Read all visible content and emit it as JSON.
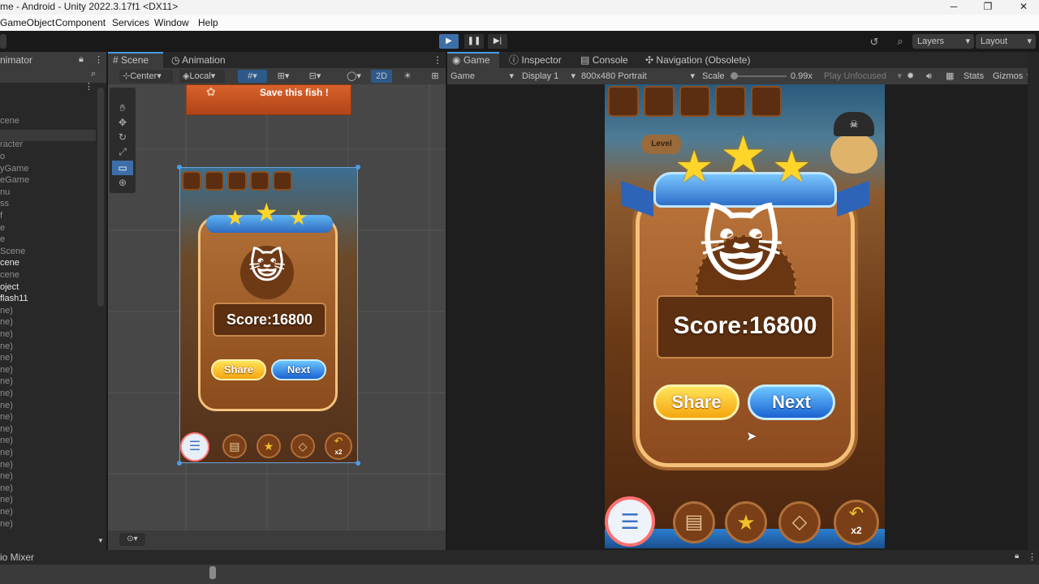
{
  "window": {
    "title": "me - Android - Unity 2022.3.17f1 <DX11>"
  },
  "menu": [
    "GameObject",
    "Component",
    "Services",
    "Window",
    "Help"
  ],
  "toolbar": {
    "layers": "Layers",
    "layout": "Layout"
  },
  "left_panel": {
    "tab": "nimator",
    "items": [
      {
        "text": "",
        "color": "grey"
      },
      {
        "text": "",
        "color": "grey"
      },
      {
        "text": "cene",
        "color": "grey"
      },
      {
        "text": "",
        "color": "grey"
      },
      {
        "text": "racter",
        "color": "grey"
      },
      {
        "text": "o",
        "color": "grey"
      },
      {
        "text": "yGame",
        "color": "grey"
      },
      {
        "text": "eGame",
        "color": "grey"
      },
      {
        "text": "nu",
        "color": "grey"
      },
      {
        "text": "ss",
        "color": "grey"
      },
      {
        "text": "f",
        "color": "grey"
      },
      {
        "text": "e",
        "color": "grey"
      },
      {
        "text": "e",
        "color": "grey"
      },
      {
        "text": "Scene",
        "color": "grey"
      },
      {
        "text": "cene",
        "color": "white"
      },
      {
        "text": "cene",
        "color": "grey"
      },
      {
        "text": "oject",
        "color": "white"
      },
      {
        "text": "flash11",
        "color": "white"
      },
      {
        "text": "ne)",
        "color": "grey"
      },
      {
        "text": "ne)",
        "color": "grey"
      },
      {
        "text": "ne)",
        "color": "grey"
      },
      {
        "text": "ne)",
        "color": "grey"
      },
      {
        "text": "ne)",
        "color": "grey"
      },
      {
        "text": "ne)",
        "color": "grey"
      },
      {
        "text": "ne)",
        "color": "grey"
      },
      {
        "text": "ne)",
        "color": "grey"
      },
      {
        "text": "ne)",
        "color": "grey"
      },
      {
        "text": "ne)",
        "color": "grey"
      },
      {
        "text": "ne)",
        "color": "grey"
      },
      {
        "text": "ne)",
        "color": "grey"
      },
      {
        "text": "ne)",
        "color": "grey"
      },
      {
        "text": "ne)",
        "color": "grey"
      },
      {
        "text": "ne)",
        "color": "grey"
      },
      {
        "text": "ne)",
        "color": "grey"
      },
      {
        "text": "ne)",
        "color": "grey"
      },
      {
        "text": "ne)",
        "color": "grey"
      },
      {
        "text": "ne)",
        "color": "grey"
      }
    ]
  },
  "scene_panel": {
    "tabs": [
      "Scene",
      "Animation"
    ],
    "pivot": "Center",
    "space": "Local",
    "mode_2d": "2D",
    "banner": "Save this fish !"
  },
  "game_panel": {
    "tabs": [
      "Game",
      "Inspector",
      "Console",
      "Navigation (Obsolete)"
    ],
    "view": "Game",
    "display": "Display 1",
    "resolution": "800x480 Portrait",
    "scale_label": "Scale",
    "scale_value": "0.99x",
    "play_mode": "Play Unfocused",
    "stats": "Stats",
    "gizmos": "Gizmos"
  },
  "game_screen": {
    "score": "Score:16800",
    "share": "Share",
    "next": "Next",
    "multiplier": "x2",
    "level": "Level"
  },
  "bottom": {
    "tab": "io Mixer"
  },
  "colors": {
    "accent": "#4c9be8",
    "wood": "#8a4f22",
    "share": "#f5b52a",
    "next": "#2f82e8"
  }
}
